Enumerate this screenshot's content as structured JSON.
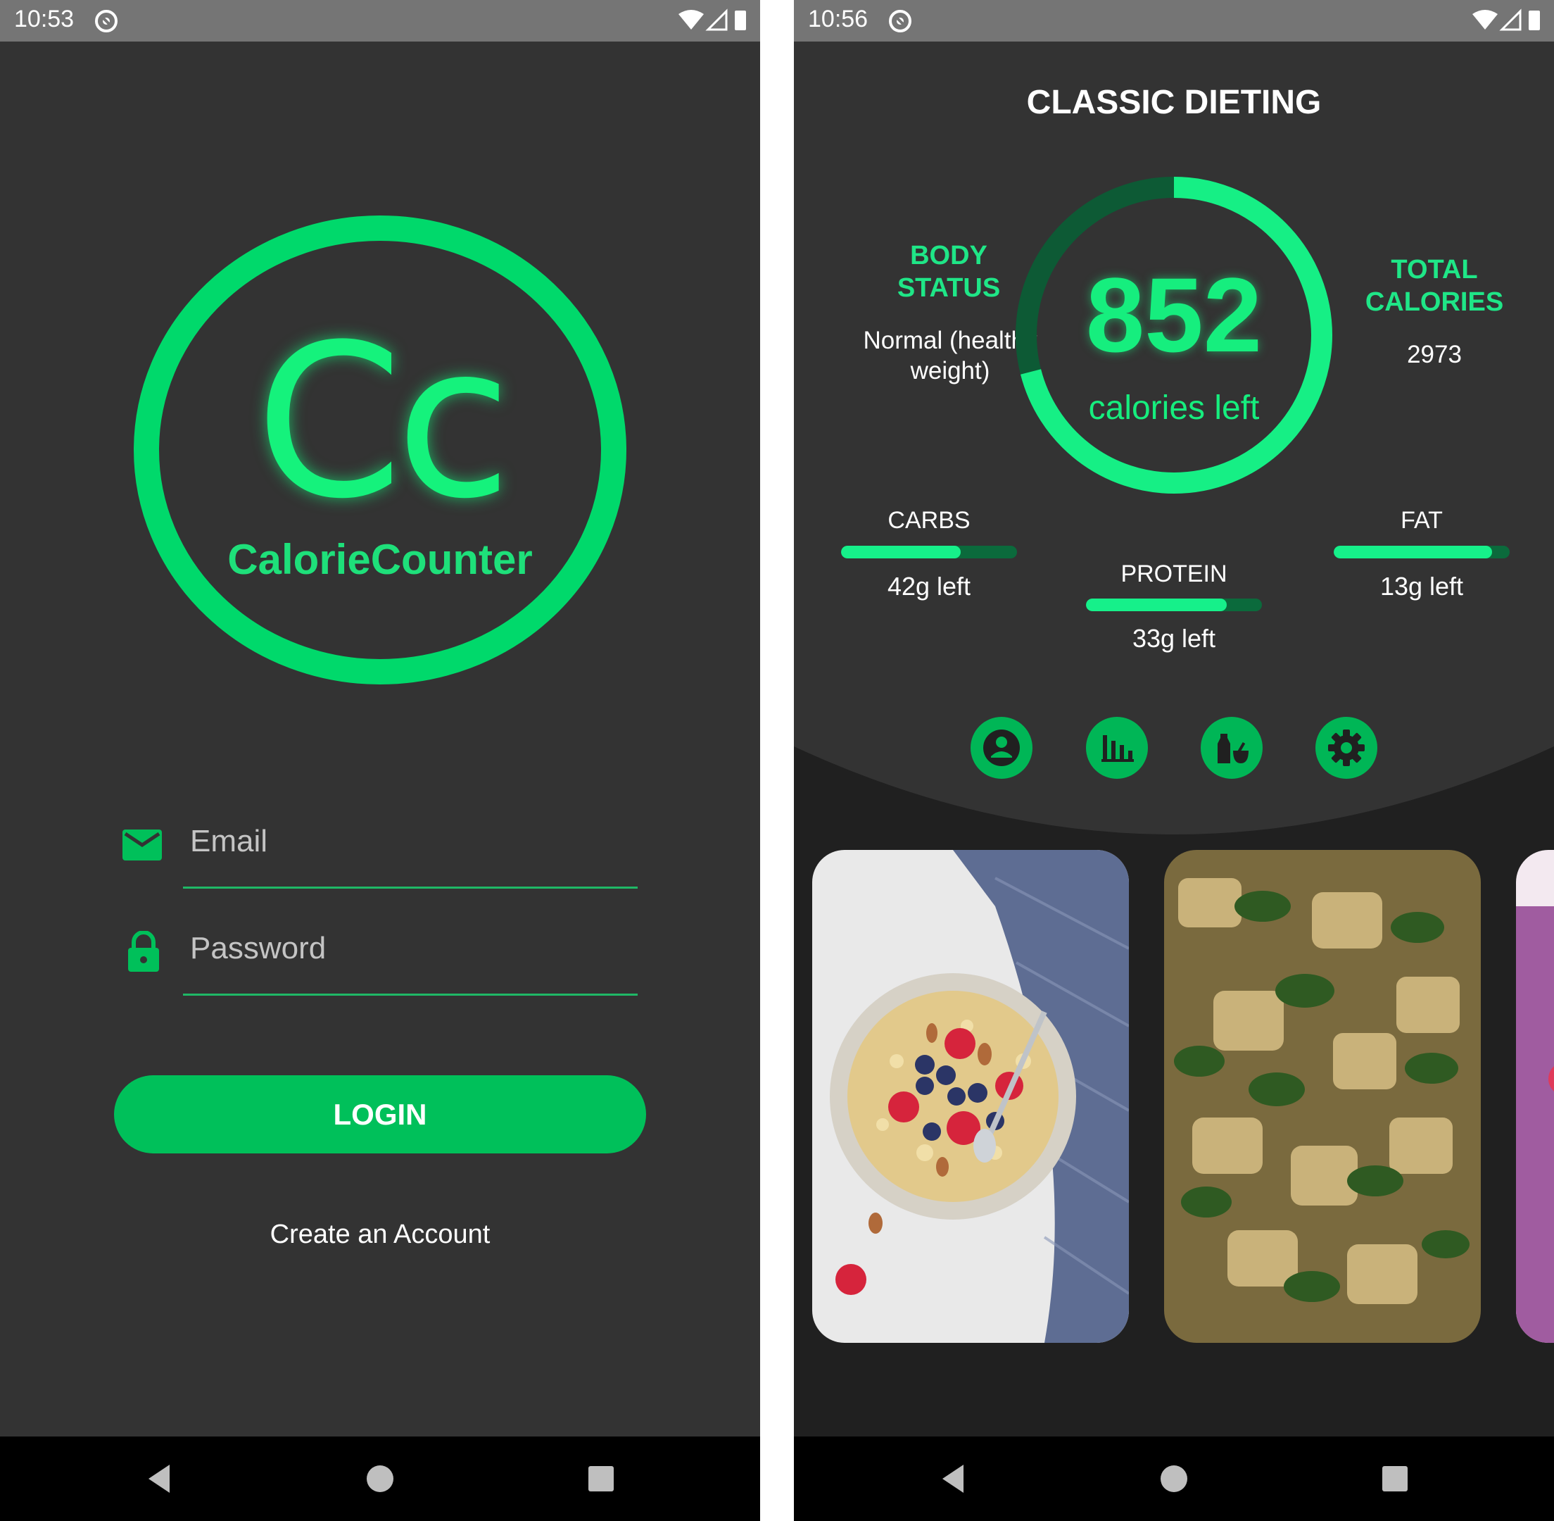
{
  "login_screen": {
    "status_bar": {
      "time": "10:53"
    },
    "logo": {
      "monogram": "Cc",
      "app_name": "CalorieCounter"
    },
    "email_field": {
      "placeholder": "Email",
      "icon": "mail-icon"
    },
    "password_field": {
      "placeholder": "Password",
      "icon": "lock-icon"
    },
    "login_button": {
      "label": "LOGIN"
    },
    "create_account_link": {
      "label": "Create an Account"
    }
  },
  "dashboard_screen": {
    "status_bar": {
      "time": "10:56"
    },
    "title": "CLASSIC DIETING",
    "body_status": {
      "heading_line1": "BODY",
      "heading_line2": "STATUS",
      "value_line1": "Normal (healthy",
      "value_line2": "weight)"
    },
    "total_calories": {
      "heading_line1": "TOTAL",
      "heading_line2": "CALORIES",
      "value": "2973"
    },
    "calories_ring": {
      "number": "852",
      "label": "calories left",
      "remaining_fraction": 0.71
    },
    "macros": {
      "carbs": {
        "label": "CARBS",
        "value": "42g left",
        "fill": 0.68
      },
      "protein": {
        "label": "PROTEIN",
        "value": "33g left",
        "fill": 0.8
      },
      "fat": {
        "label": "FAT",
        "value": "13g left",
        "fill": 0.9
      }
    },
    "actions": [
      "profile-icon",
      "bar-chart-icon",
      "meal-icon",
      "settings-icon"
    ],
    "food_cards": [
      "oatmeal-with-berries",
      "chicken-rice-spinach",
      "berry-smoothie"
    ]
  },
  "colors": {
    "accent": "#16ee7e",
    "button": "#00c05a",
    "background": "#333333",
    "dark_panel": "#202020"
  }
}
